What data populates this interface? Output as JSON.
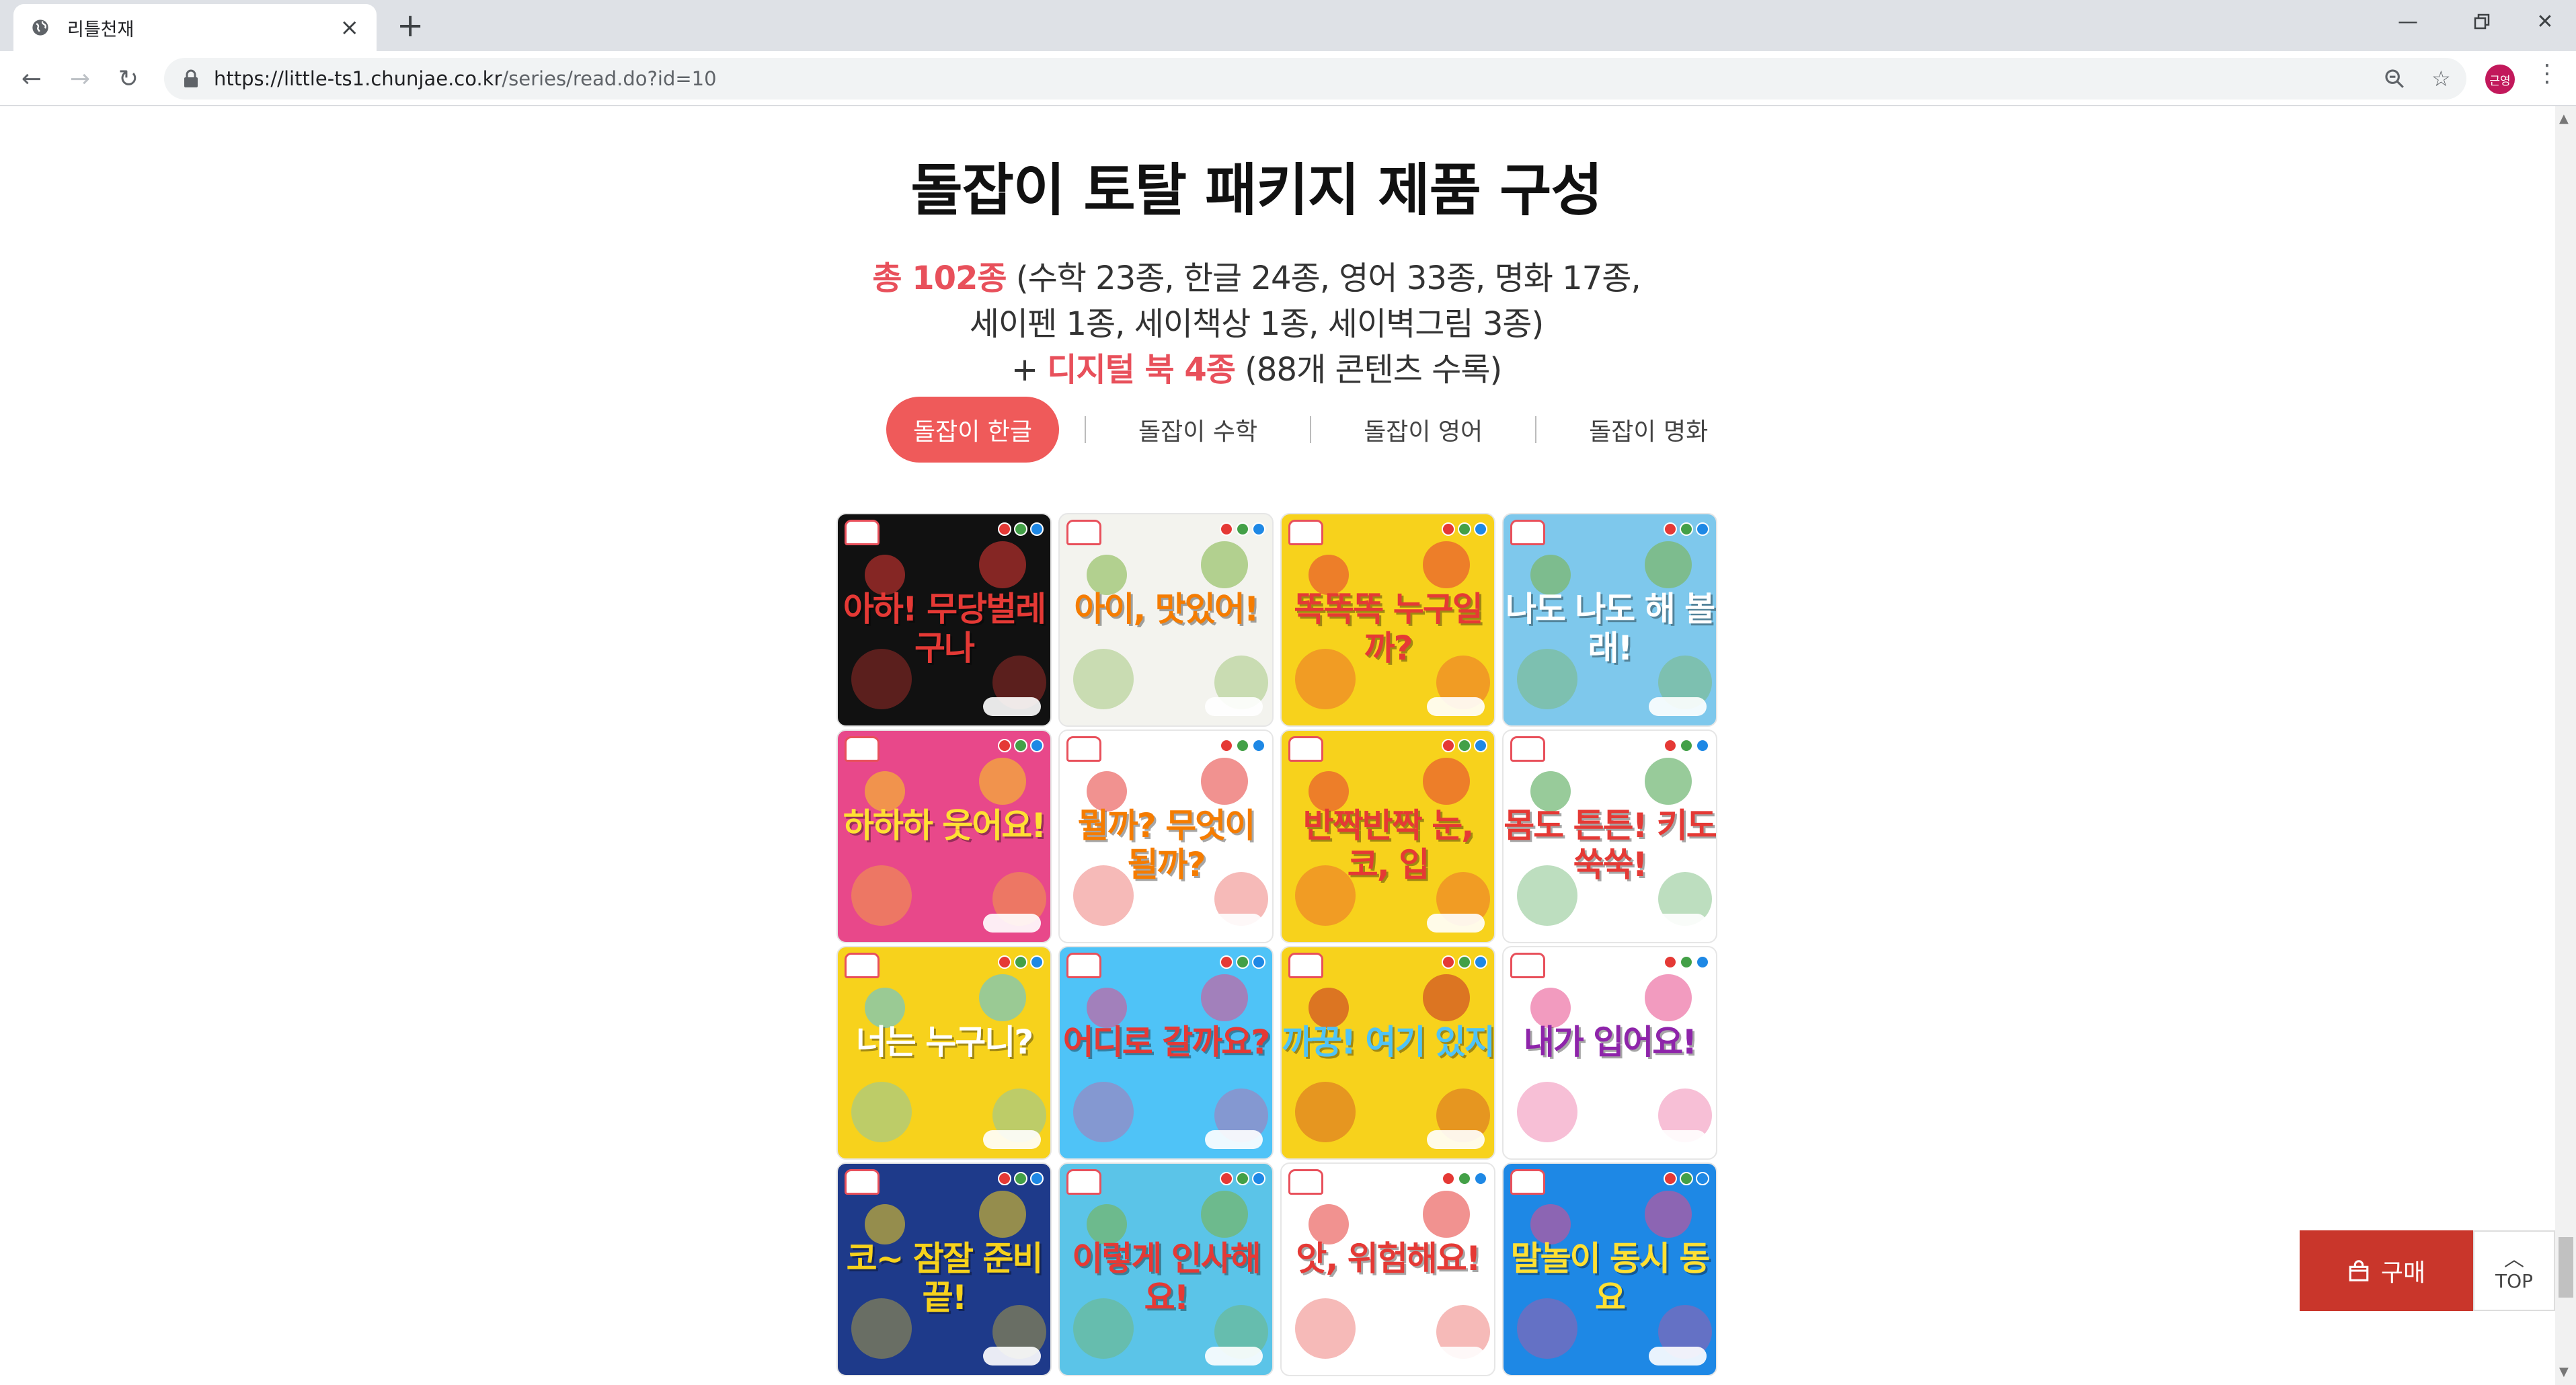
{
  "browser": {
    "tab_title": "리틀천재",
    "url_host": "https://little-ts1.chunjae.co.kr",
    "url_path": "/series/read.do?id=10",
    "profile_initials": "근영"
  },
  "page": {
    "headline": "돌잡이 토탈 패키지 제품 구성",
    "summary": {
      "total": "총 102종",
      "line1_rest": " (수학 23종, 한글 24종, 영어 33종, 명화 17종,",
      "line2": "세이펜 1종, 세이책상 1종, 세이벽그림 3종)",
      "line3_prefix": "+ ",
      "digital": "디지털 북 4종",
      "line3_rest": " (88개 콘텐츠 수록)"
    },
    "tabs": [
      {
        "label": "돌잡이 한글",
        "active": true
      },
      {
        "label": "돌잡이 수학",
        "active": false
      },
      {
        "label": "돌잡이 영어",
        "active": false
      },
      {
        "label": "돌잡이 명화",
        "active": false
      }
    ],
    "books": [
      {
        "title": "아하! 무당벌레구나",
        "bg": "#111111",
        "accent": "#e53935",
        "color": "#e53935"
      },
      {
        "title": "아이, 맛있어!",
        "bg": "#f3f3ee",
        "accent": "#7cb342",
        "color": "#f57c00"
      },
      {
        "title": "똑똑똑 누구일까?",
        "bg": "#f7d21c",
        "accent": "#e53935",
        "color": "#e53935"
      },
      {
        "title": "나도 나도 해 볼래!",
        "bg": "#7ec8ec",
        "accent": "#7cb342",
        "color": "#ffffff"
      },
      {
        "title": "하하하 웃어요!",
        "bg": "#e8488a",
        "accent": "#f7d21c",
        "color": "#ffe033"
      },
      {
        "title": "뭘까? 무엇이 될까?",
        "bg": "#ffffff",
        "accent": "#e53935",
        "color": "#f57c00"
      },
      {
        "title": "반짝반짝 눈, 코, 입",
        "bg": "#f7d21c",
        "accent": "#e53935",
        "color": "#e53935"
      },
      {
        "title": "몸도 튼튼! 키도 쑥쑥!",
        "bg": "#ffffff",
        "accent": "#43a047",
        "color": "#e53935"
      },
      {
        "title": "너는 누구니?",
        "bg": "#f7d21c",
        "accent": "#4fc3f7",
        "color": "#ffffff"
      },
      {
        "title": "어디로 갈까요?",
        "bg": "#4fc3f7",
        "accent": "#e8488a",
        "color": "#e53935"
      },
      {
        "title": "까꿍! 여기 있지",
        "bg": "#f7d21c",
        "accent": "#c62828",
        "color": "#4fc3f7"
      },
      {
        "title": "내가 입어요!",
        "bg": "#ffffff",
        "accent": "#e8488a",
        "color": "#8e24aa"
      },
      {
        "title": "코~ 잠잘 준비 끝!",
        "bg": "#1e3a8a",
        "accent": "#f7d21c",
        "color": "#f7d21c"
      },
      {
        "title": "이렇게 인사해요!",
        "bg": "#5bc4e8",
        "accent": "#7cb342",
        "color": "#e53935"
      },
      {
        "title": "앗, 위험해요!",
        "bg": "#ffffff",
        "accent": "#e53935",
        "color": "#e53935"
      },
      {
        "title": "말놀이 동시 동요",
        "bg": "#1e88e5",
        "accent": "#e8488a",
        "color": "#ffe033"
      }
    ]
  },
  "floating": {
    "buy_label": "구매",
    "top_label": "TOP"
  }
}
